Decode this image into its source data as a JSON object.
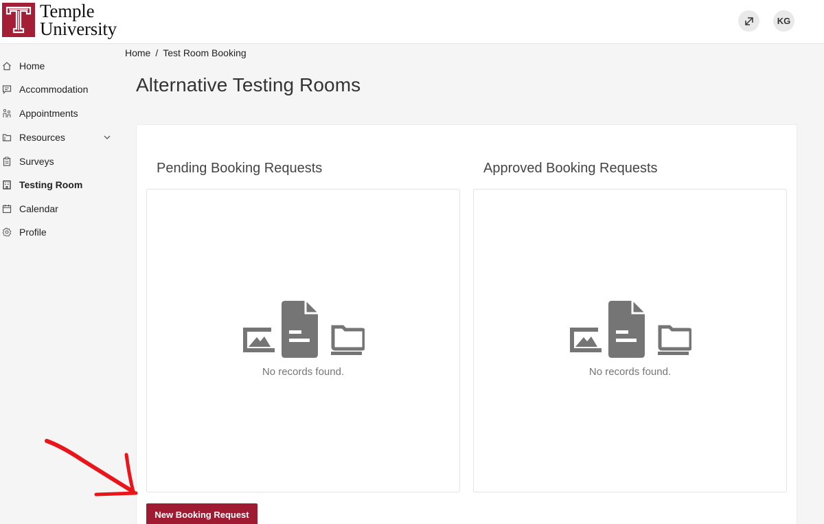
{
  "brand": {
    "line1": "Temple",
    "line2": "University"
  },
  "header": {
    "avatar_initials": "KG"
  },
  "sidebar": {
    "items": [
      {
        "label": "Home",
        "icon": "home-icon"
      },
      {
        "label": "Accommodation",
        "icon": "chat-icon"
      },
      {
        "label": "Appointments",
        "icon": "people-icon"
      },
      {
        "label": "Resources",
        "icon": "folder-icon"
      },
      {
        "label": "Surveys",
        "icon": "clipboard-icon"
      },
      {
        "label": "Testing Room",
        "icon": "building-icon",
        "active": true
      },
      {
        "label": "Calendar",
        "icon": "calendar-icon"
      },
      {
        "label": "Profile",
        "icon": "gear-icon"
      }
    ]
  },
  "breadcrumb": {
    "home": "Home",
    "separator": "/",
    "current": "Test Room Booking"
  },
  "page": {
    "title": "Alternative Testing Rooms"
  },
  "pending": {
    "title": "Pending Booking Requests",
    "empty_text": "No records found."
  },
  "approved": {
    "title": "Approved Booking Requests",
    "empty_text": "No records found."
  },
  "actions": {
    "new_booking_label": "New Booking Request"
  },
  "colors": {
    "brand": "#a41e35",
    "button": "#9e1b32",
    "annotation": "#e8161b"
  }
}
